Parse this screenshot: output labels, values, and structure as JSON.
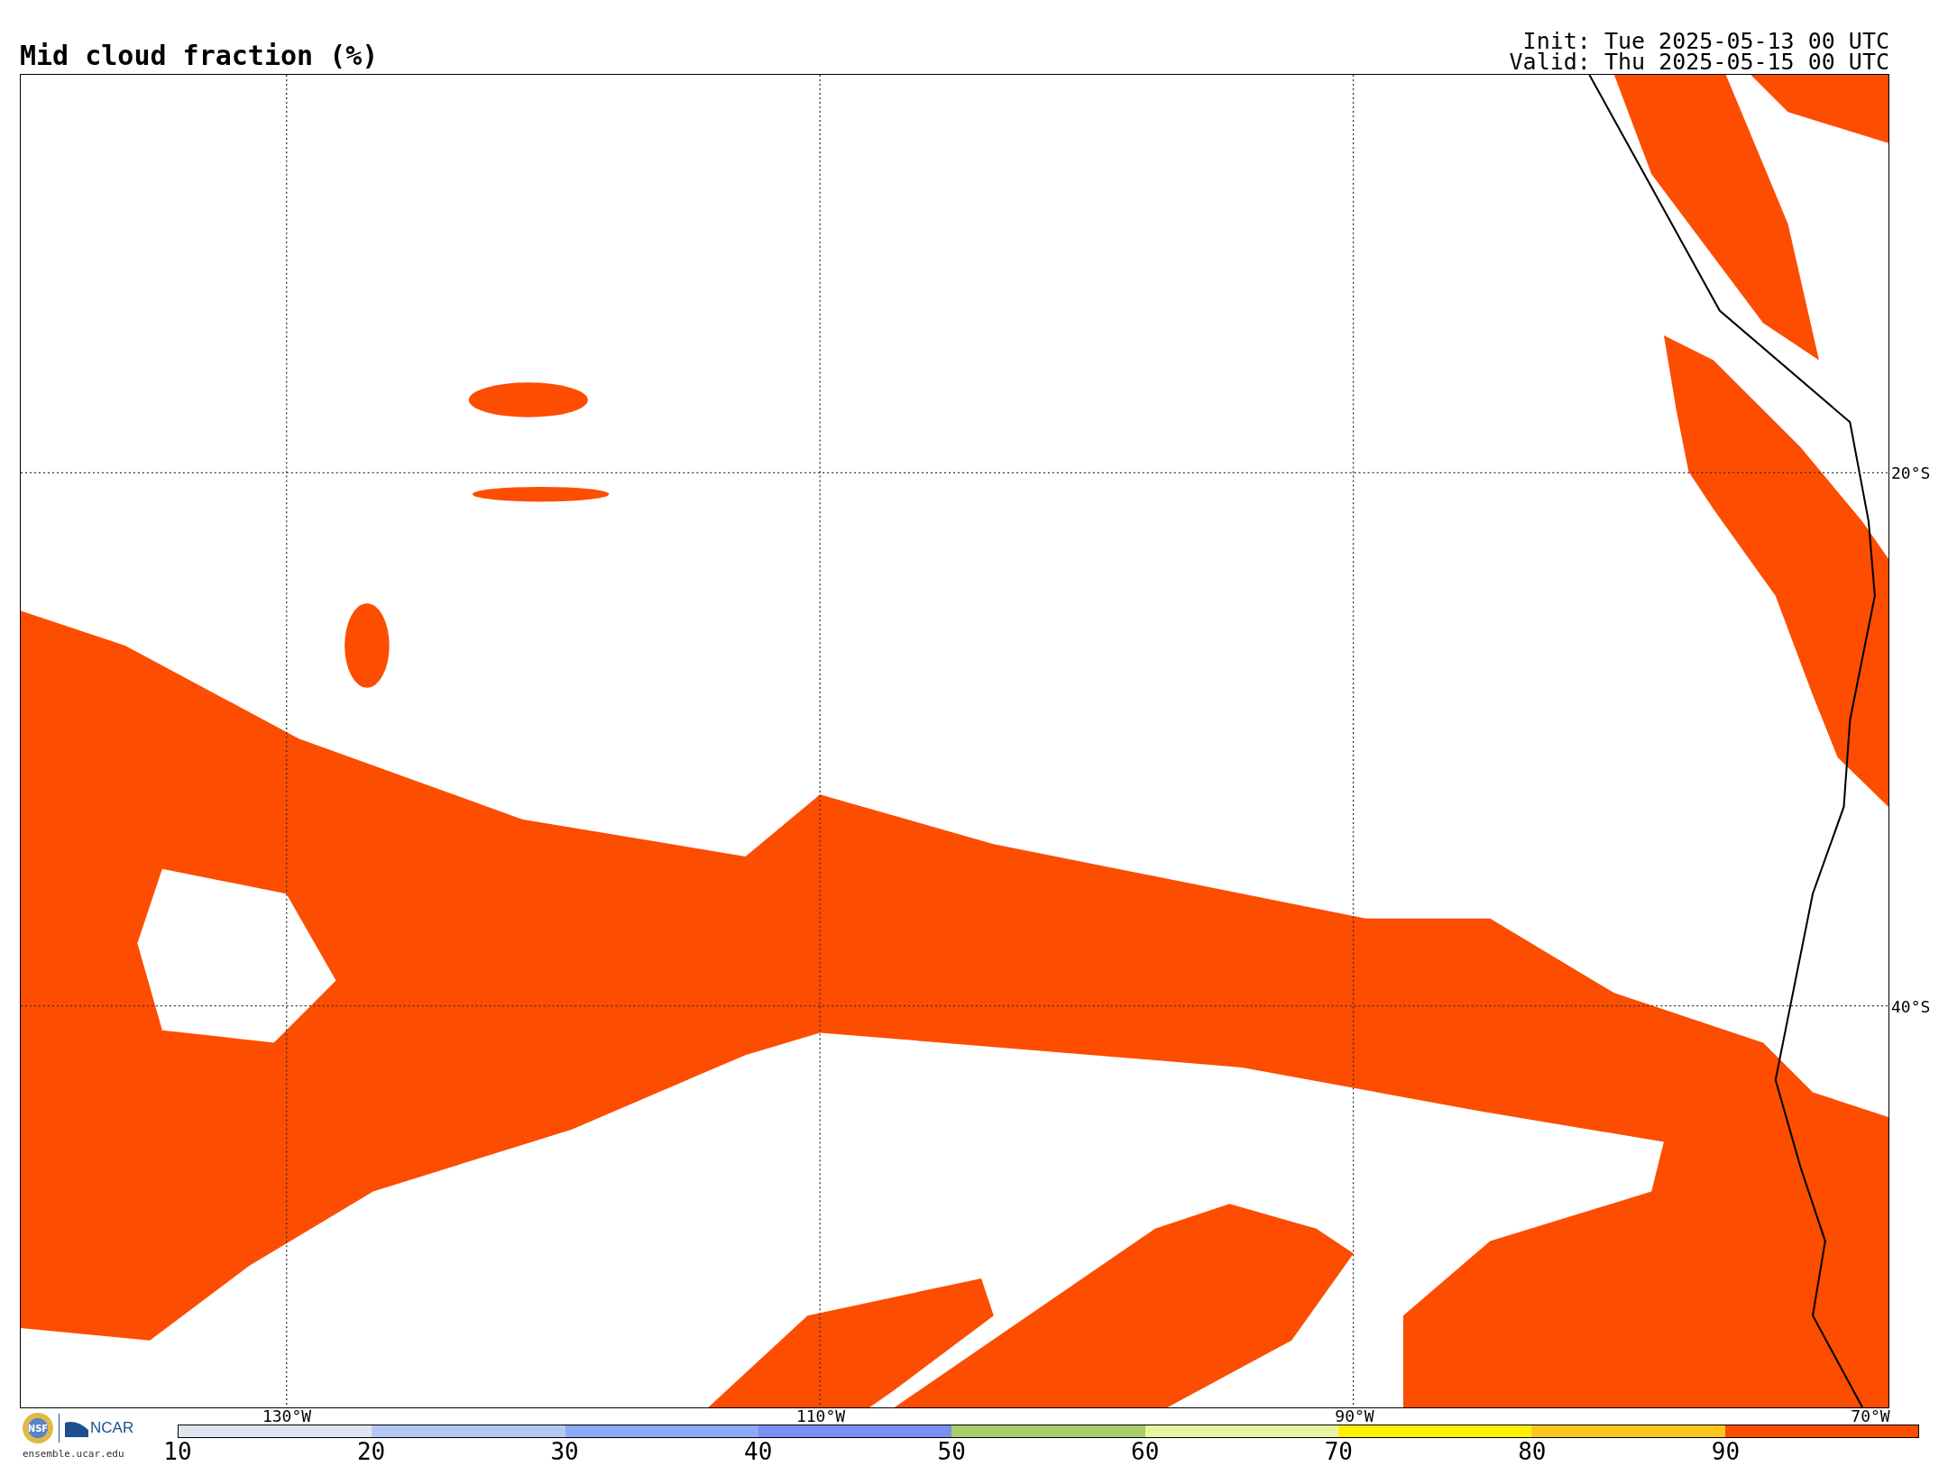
{
  "title": "Mid cloud fraction (%)",
  "init": "Init: Tue 2025-05-13 00 UTC",
  "valid": "Valid: Thu 2025-05-15 00 UTC",
  "map": {
    "lat_labels": [
      "20°S",
      "40°S"
    ],
    "lon_labels": [
      "130°W",
      "110°W",
      "90°W",
      "70°W"
    ]
  },
  "logo": {
    "seal": "NSF",
    "name": "NCAR",
    "site": "ensemble.ucar.edu"
  },
  "colorbar": {
    "bins": [
      {
        "color": "#dde6ee"
      },
      {
        "color": "#b4c8f5"
      },
      {
        "color": "#8caaf5"
      },
      {
        "color": "#7b8ef2"
      },
      {
        "color": "#a8cd6a"
      },
      {
        "color": "#e8f5a0"
      },
      {
        "color": "#ffef00"
      },
      {
        "color": "#fcc820"
      },
      {
        "color": "#fd4d00"
      }
    ],
    "ticks": [
      "10",
      "20",
      "30",
      "40",
      "50",
      "60",
      "70",
      "80",
      "90"
    ]
  }
}
